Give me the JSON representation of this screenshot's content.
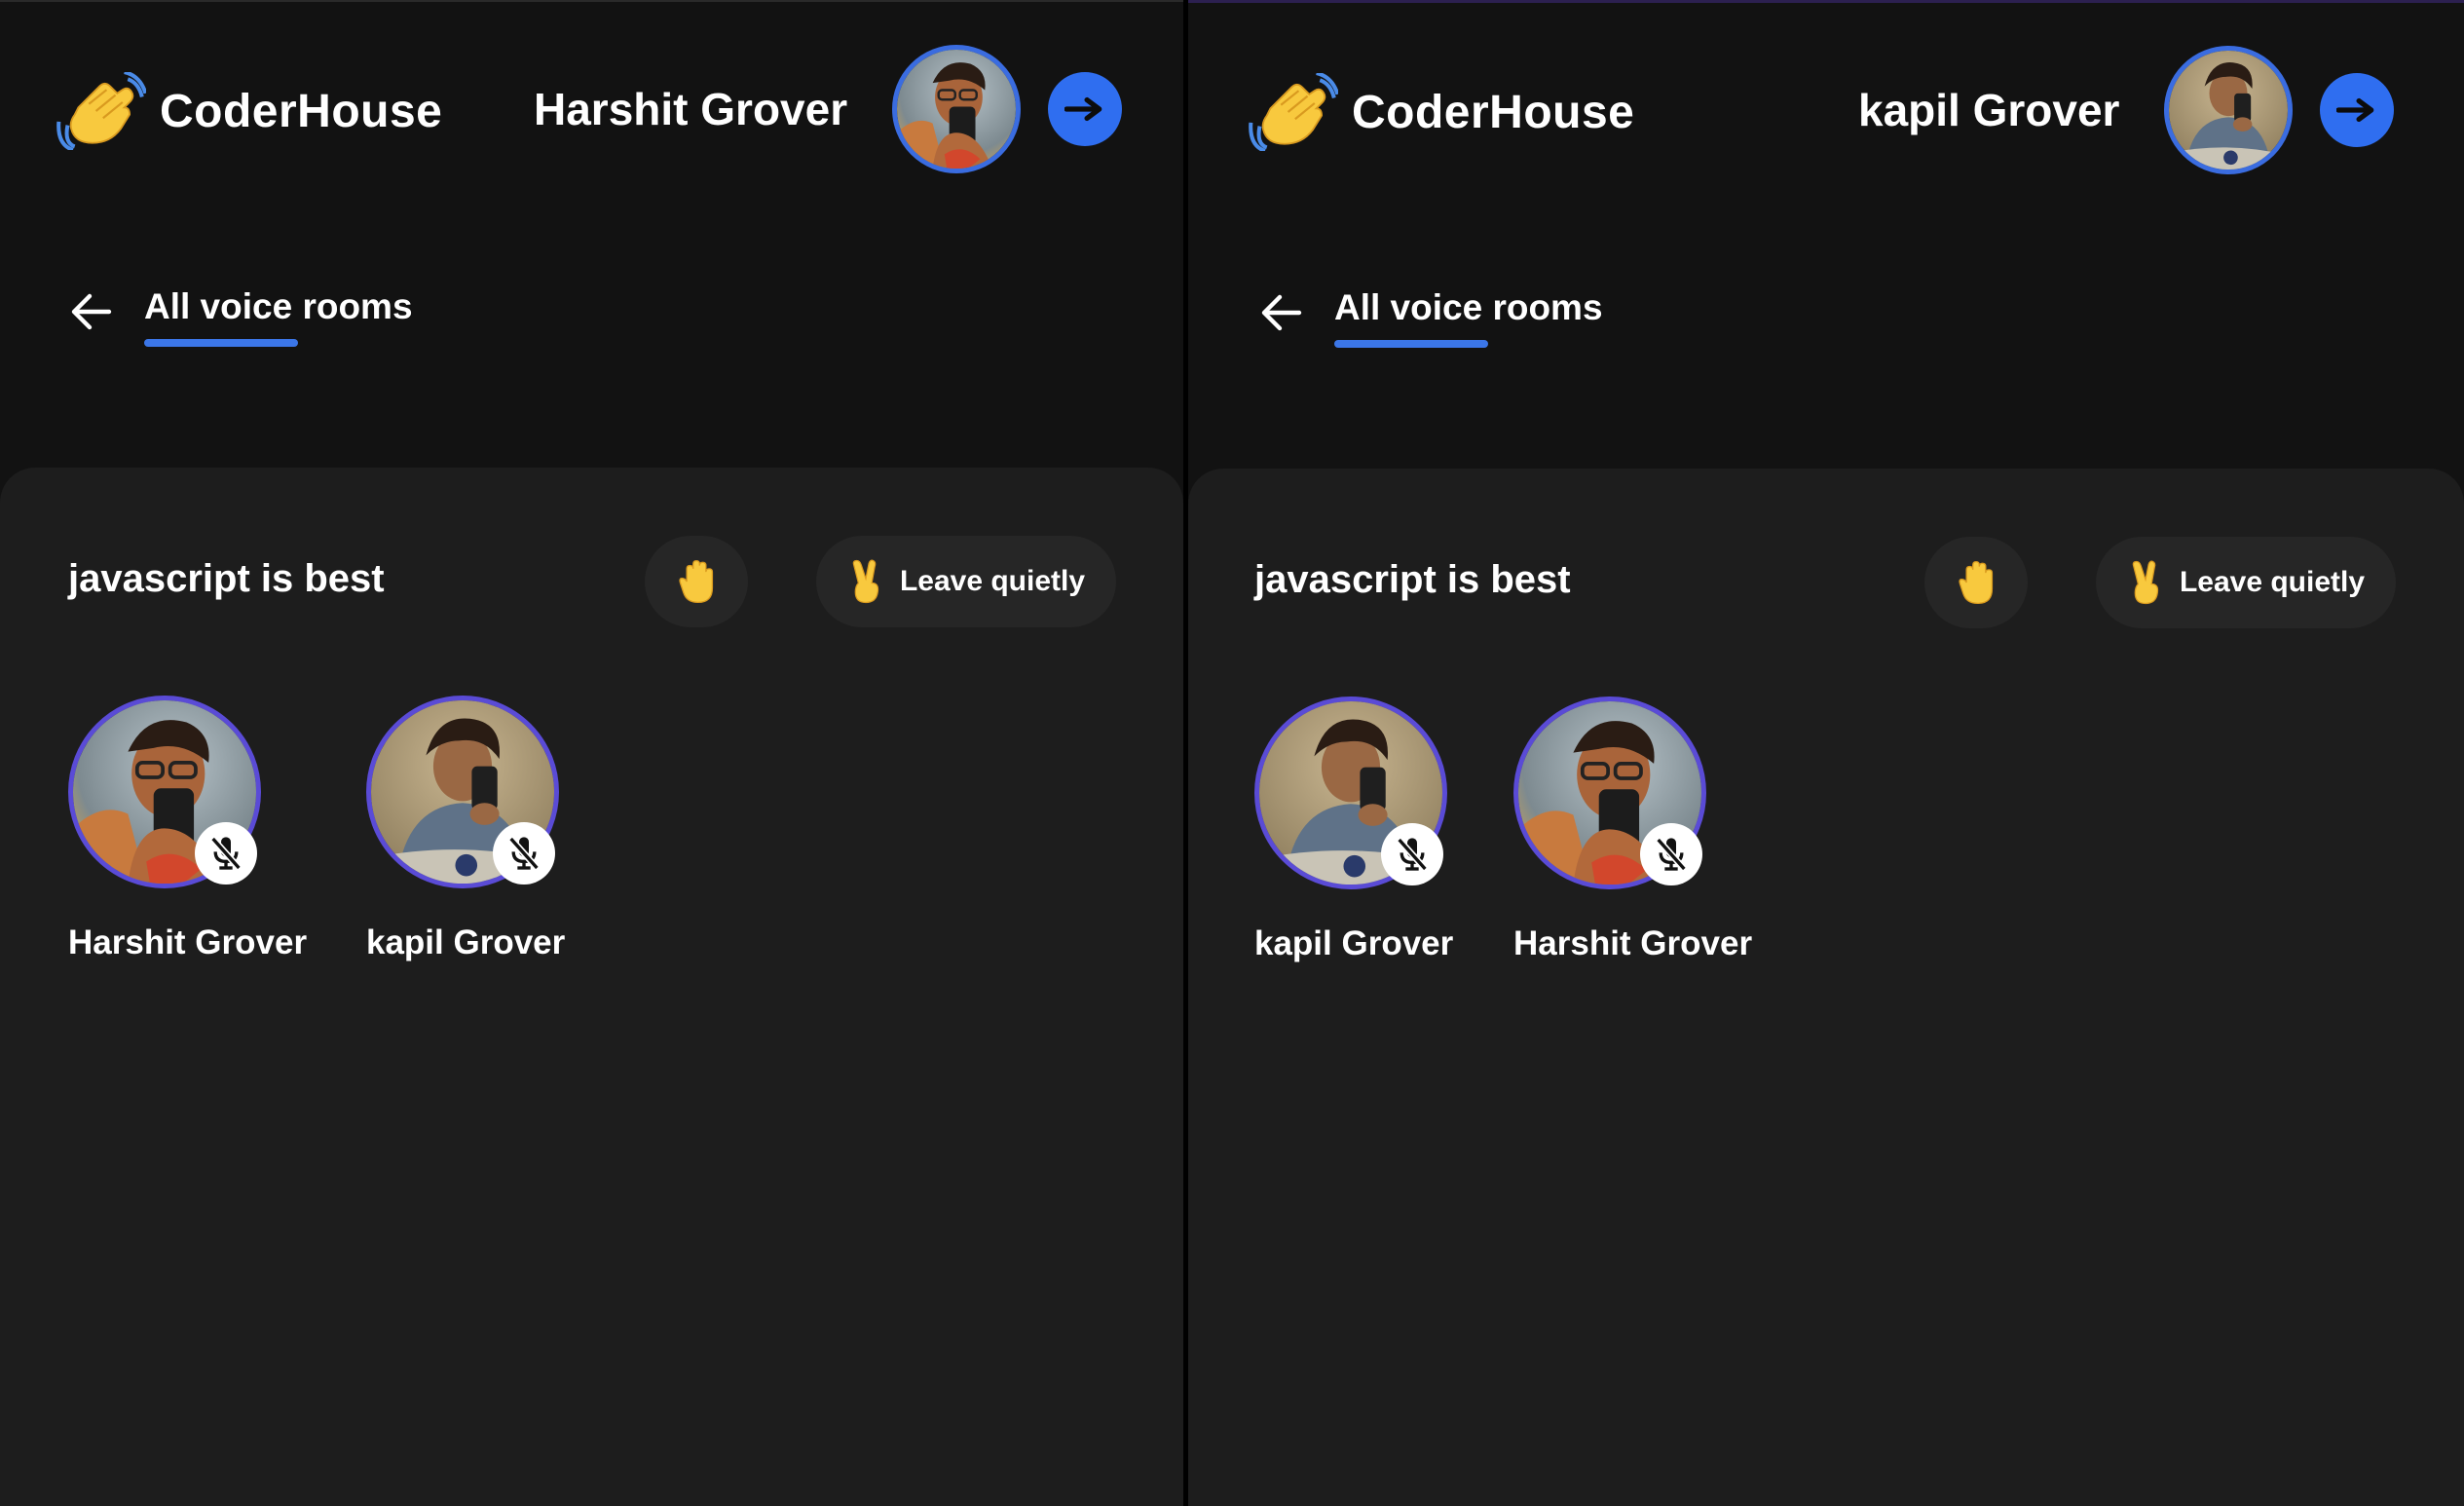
{
  "app": {
    "name": "CoderHouse",
    "brand_color": "#2f6ef0",
    "background": "#121212",
    "panel_background": "#1d1d1d"
  },
  "windows": [
    {
      "header": {
        "logo_text": "CoderHouse",
        "logo_icon": "waving-hand-icon",
        "user_name": "Harshit Grover",
        "avatar_icon": "user-avatar",
        "logout_icon": "logout-arrow-icon"
      },
      "nav": {
        "back_icon": "arrow-left-icon",
        "title": "All voice rooms"
      },
      "room": {
        "topic": "javascript is best",
        "raise_hand_icon": "raised-hand-icon",
        "leave_button_label": "Leave quietly",
        "leave_icon": "victory-hand-icon",
        "clients": [
          {
            "name": "Harshit Grover",
            "muted": true,
            "mic_icon": "mic-off-icon"
          },
          {
            "name": "kapil Grover",
            "muted": true,
            "mic_icon": "mic-off-icon"
          }
        ]
      }
    },
    {
      "header": {
        "logo_text": "CoderHouse",
        "logo_icon": "waving-hand-icon",
        "user_name": "kapil Grover",
        "avatar_icon": "user-avatar",
        "logout_icon": "logout-arrow-icon"
      },
      "nav": {
        "back_icon": "arrow-left-icon",
        "title": "All voice rooms"
      },
      "room": {
        "topic": "javascript is best",
        "raise_hand_icon": "raised-hand-icon",
        "leave_button_label": "Leave quietly",
        "leave_icon": "victory-hand-icon",
        "clients": [
          {
            "name": "kapil Grover",
            "muted": true,
            "mic_icon": "mic-off-icon"
          },
          {
            "name": "Harshit Grover",
            "muted": true,
            "mic_icon": "mic-off-icon"
          }
        ]
      }
    }
  ]
}
